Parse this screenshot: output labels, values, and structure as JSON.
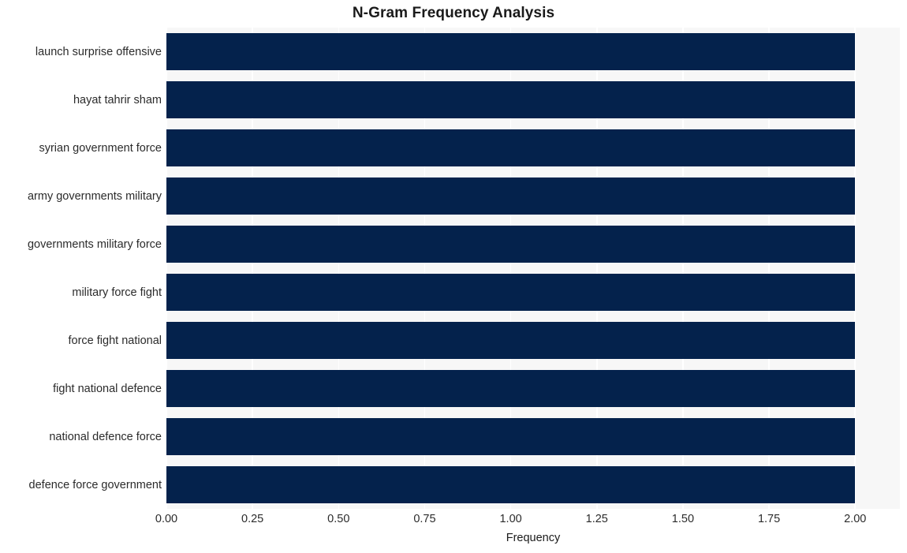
{
  "chart_data": {
    "type": "bar",
    "orientation": "horizontal",
    "title": "N-Gram Frequency Analysis",
    "xlabel": "Frequency",
    "ylabel": "",
    "categories": [
      "launch surprise offensive",
      "hayat tahrir sham",
      "syrian government force",
      "army governments military",
      "governments military force",
      "military force fight",
      "force fight national",
      "fight national defence",
      "national defence force",
      "defence force government"
    ],
    "values": [
      2,
      2,
      2,
      2,
      2,
      2,
      2,
      2,
      2,
      2
    ],
    "xlim": [
      0.0,
      2.13
    ],
    "xticks": [
      0.0,
      0.25,
      0.5,
      0.75,
      1.0,
      1.25,
      1.5,
      1.75,
      2.0
    ],
    "xticklabels": [
      "0.00",
      "0.25",
      "0.50",
      "0.75",
      "1.00",
      "1.25",
      "1.50",
      "1.75",
      "2.00"
    ],
    "grid": true,
    "grid_axis": "x",
    "legend": false,
    "bar_color": "#04224c",
    "plot_background": "#f7f7f7",
    "figure_background": "#ffffff",
    "gridline_color": "#ffffff"
  }
}
